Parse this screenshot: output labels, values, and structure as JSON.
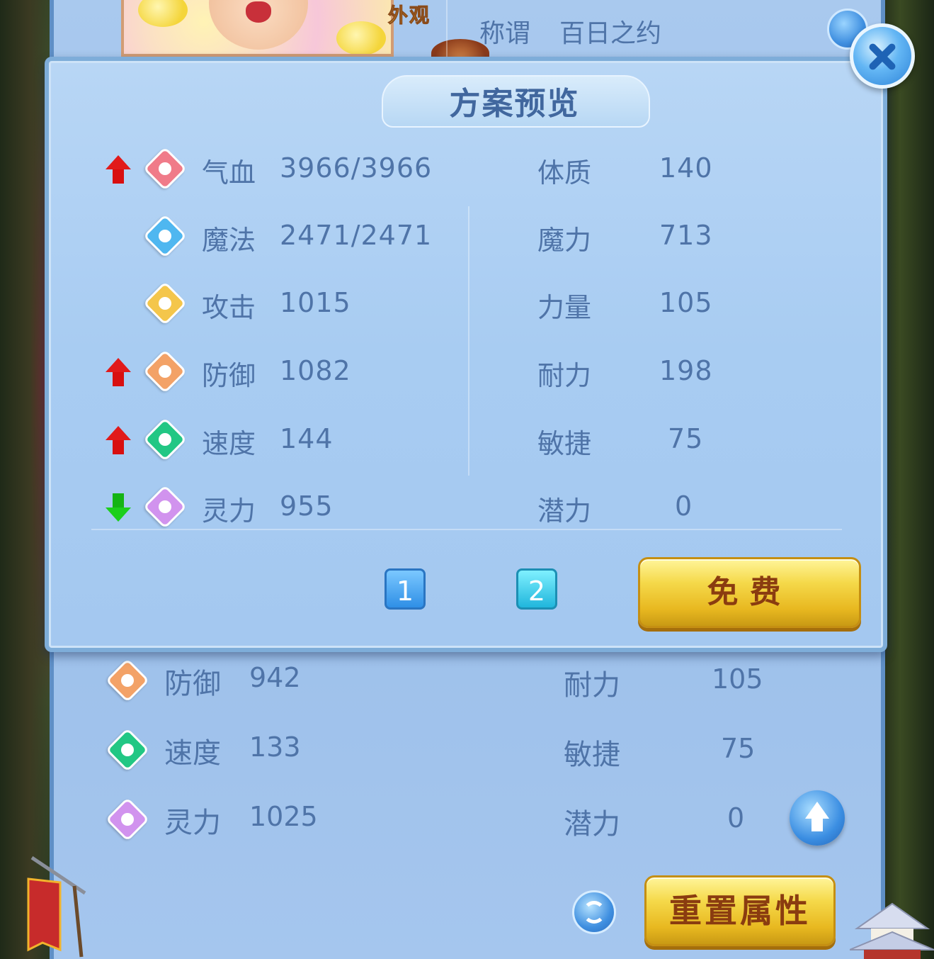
{
  "character": {
    "tab_label": "外观",
    "title_label": "称谓",
    "title_value": "百日之约"
  },
  "attributes": {
    "rows": [
      {
        "icon": "shield-icon",
        "label": "防御",
        "value": "942",
        "attr_label": "耐力",
        "attr_value": "105"
      },
      {
        "icon": "speed-icon",
        "label": "速度",
        "value": "133",
        "attr_label": "敏捷",
        "attr_value": "75"
      },
      {
        "icon": "spirit-icon",
        "label": "灵力",
        "value": "1025",
        "attr_label": "潜力",
        "attr_value": "0"
      }
    ],
    "reset_label": "重置属性"
  },
  "preview": {
    "title": "方案预览",
    "stats": [
      {
        "trend": "up",
        "icon": "heart-icon",
        "label": "气血",
        "value": "3966/3966"
      },
      {
        "trend": "none",
        "icon": "mana-icon",
        "label": "魔法",
        "value": "2471/2471"
      },
      {
        "trend": "none",
        "icon": "sword-icon",
        "label": "攻击",
        "value": "1015"
      },
      {
        "trend": "up",
        "icon": "shield-icon",
        "label": "防御",
        "value": "1082"
      },
      {
        "trend": "up",
        "icon": "speed-icon",
        "label": "速度",
        "value": "144"
      },
      {
        "trend": "down",
        "icon": "spirit-icon",
        "label": "灵力",
        "value": "955"
      }
    ],
    "attrs": [
      {
        "label": "体质",
        "value": "140"
      },
      {
        "label": "魔力",
        "value": "713"
      },
      {
        "label": "力量",
        "value": "105"
      },
      {
        "label": "耐力",
        "value": "198"
      },
      {
        "label": "敏捷",
        "value": "75"
      },
      {
        "label": "潜力",
        "value": "0"
      }
    ],
    "pages": [
      "1",
      "2"
    ],
    "free_label": "免费"
  },
  "colors": {
    "panel": "#a8ccf2",
    "text": "#4f74a8",
    "up_arrow": "#e11a1a",
    "down_arrow": "#1ccf1c",
    "gold_button": "#f5d94a"
  }
}
